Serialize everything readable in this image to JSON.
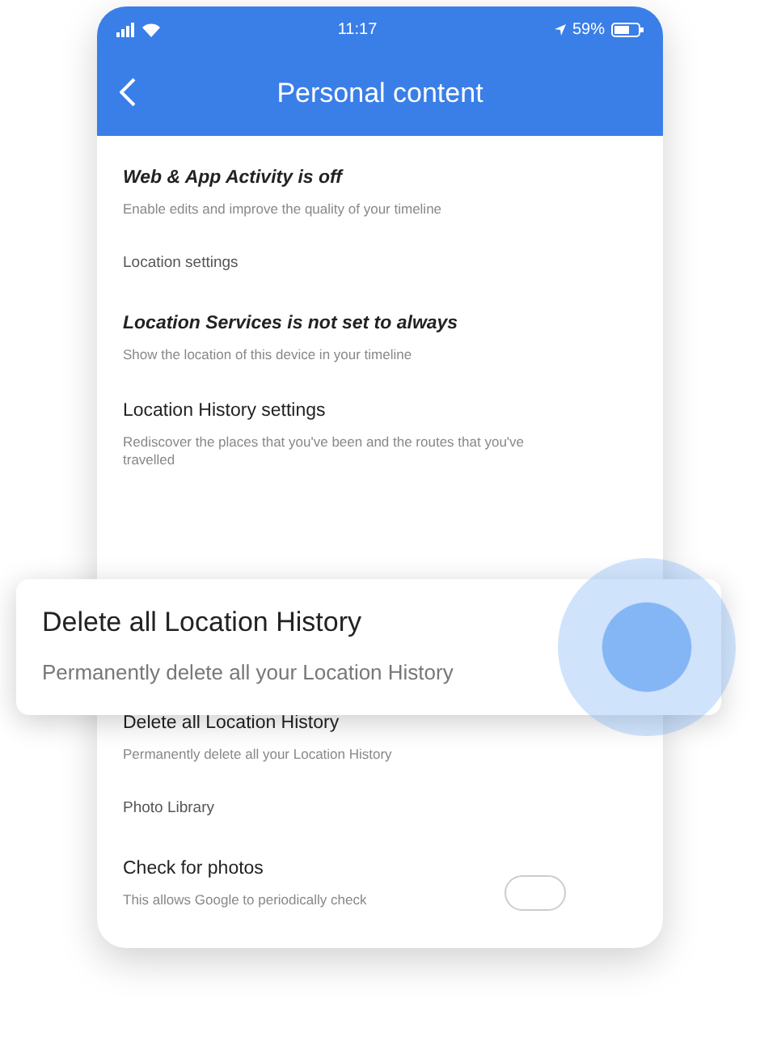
{
  "status_bar": {
    "time": "11:17",
    "battery": "59%"
  },
  "header": {
    "title": "Personal content"
  },
  "items": [
    {
      "kind": "setting",
      "emphasis": true,
      "title": "Web & App Activity is off",
      "subtitle": "Enable edits and improve the quality of your timeline"
    },
    {
      "kind": "section",
      "title": "Location settings"
    },
    {
      "kind": "setting",
      "emphasis": true,
      "title": "Location Services is not set to always",
      "subtitle": "Show the location of this device in your timeline"
    },
    {
      "kind": "setting",
      "emphasis": false,
      "title": "Location History settings",
      "subtitle": "Rediscover the places that you've been and the routes that you've travelled"
    },
    {
      "kind": "gap"
    },
    {
      "kind": "setting",
      "emphasis": false,
      "title": "Delete all Location History",
      "subtitle": "Permanently delete all your Location History"
    },
    {
      "kind": "section",
      "title": "Photo Library"
    },
    {
      "kind": "toggle",
      "on": false,
      "title": "Check for photos",
      "subtitle": "This allows Google to periodically check"
    }
  ],
  "popup": {
    "title": "Delete all Location History",
    "subtitle": "Permanently delete all your Location History"
  }
}
